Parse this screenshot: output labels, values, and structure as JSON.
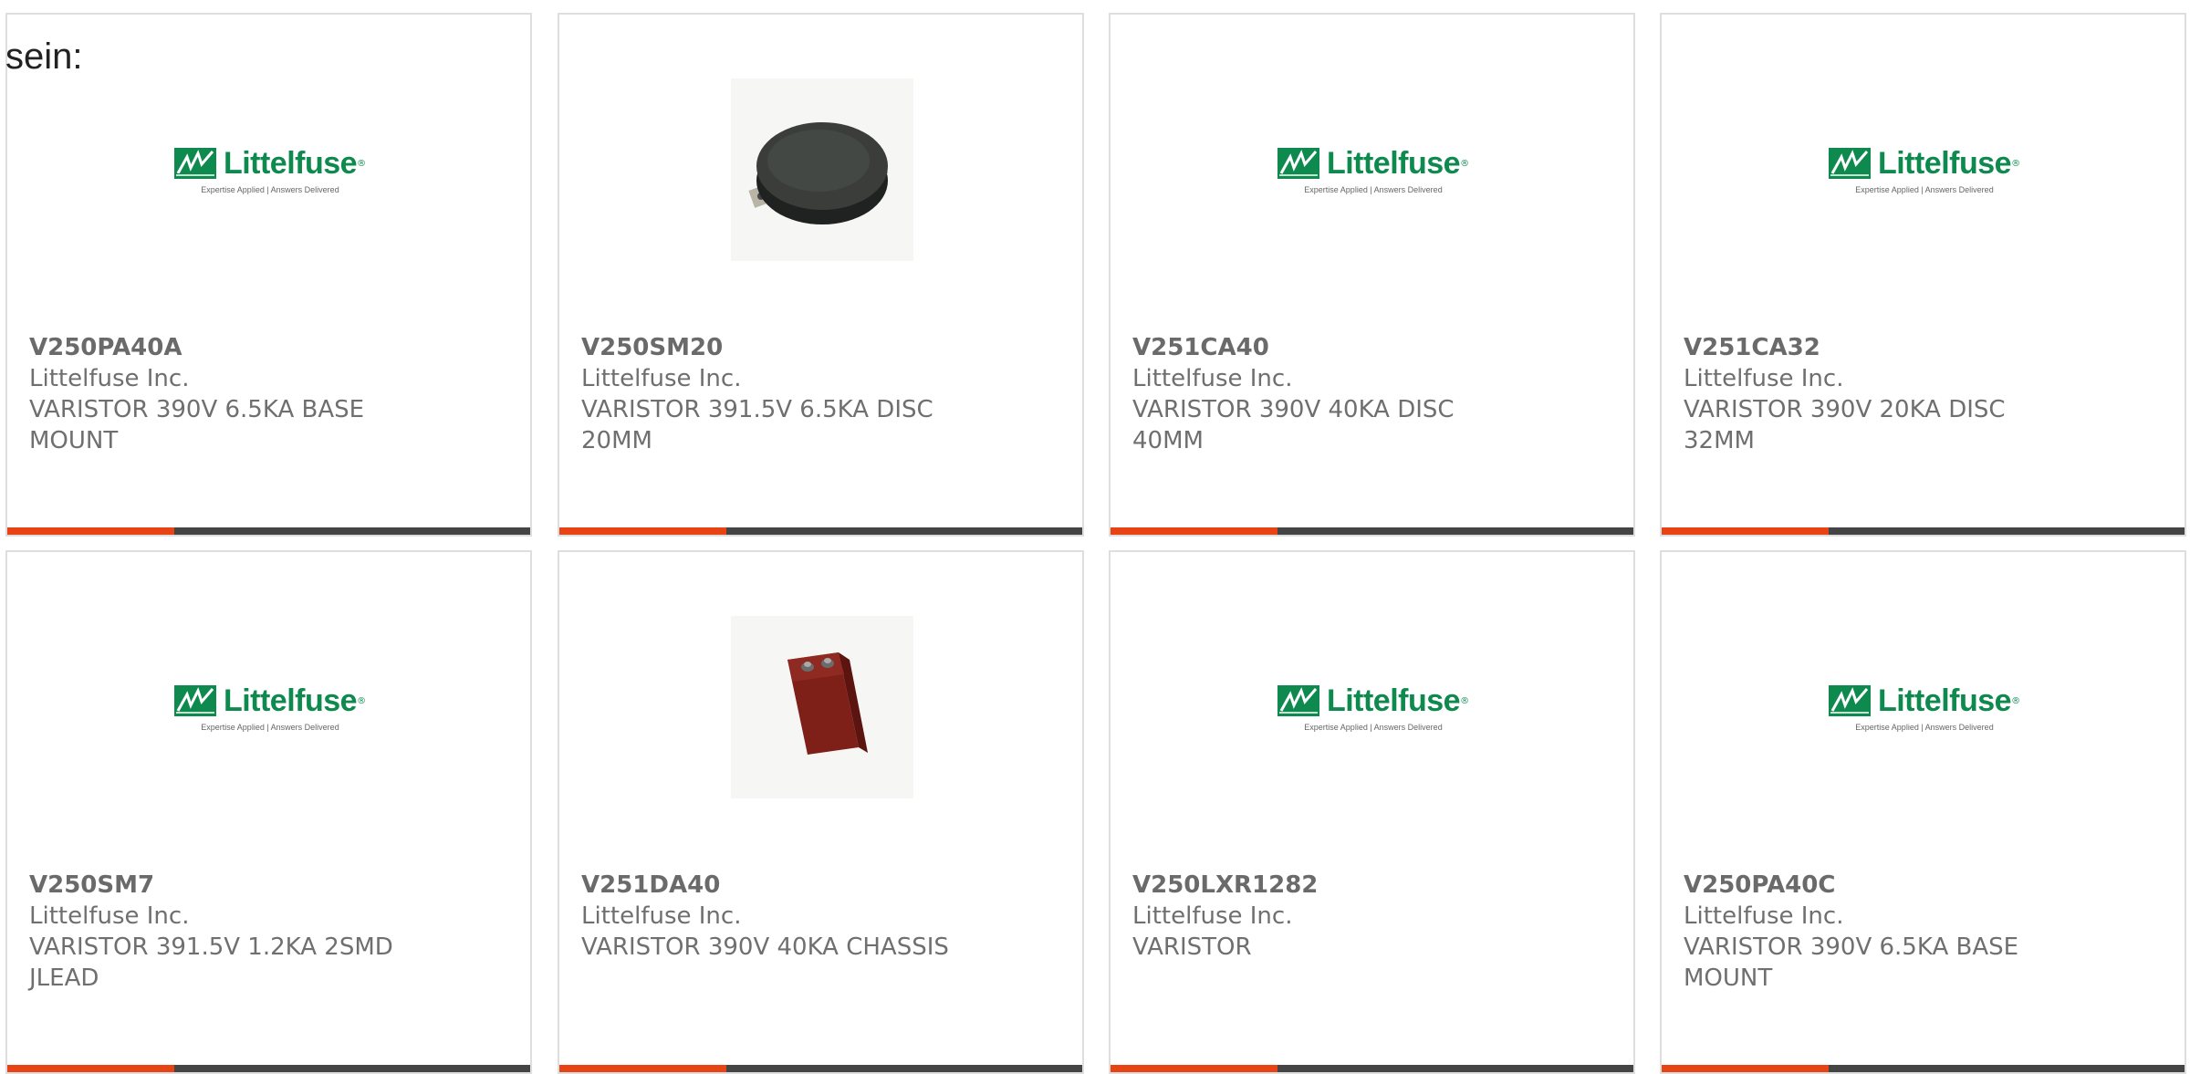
{
  "intro_text": "sein:",
  "logo": {
    "word": "Littelfuse",
    "reg": "®",
    "tagline": "Expertise Applied | Answers Delivered"
  },
  "colors": {
    "brand_green": "#0f8a4f",
    "accent_orange": "#e84314",
    "bar_dark": "#444444"
  },
  "products": [
    {
      "part_number": "V250PA40A",
      "manufacturer": "Littelfuse Inc.",
      "description": "VARISTOR 390V 6.5KA BASE MOUNT",
      "image": "littelfuse-logo"
    },
    {
      "part_number": "V250SM20",
      "manufacturer": "Littelfuse Inc.",
      "description": "VARISTOR 391.5V 6.5KA DISC 20MM",
      "image": "black-disc-varistor"
    },
    {
      "part_number": "V251CA40",
      "manufacturer": "Littelfuse Inc.",
      "description": "VARISTOR 390V 40KA DISC 40MM",
      "image": "littelfuse-logo"
    },
    {
      "part_number": "V251CA32",
      "manufacturer": "Littelfuse Inc.",
      "description": "VARISTOR 390V 20KA DISC 32MM",
      "image": "littelfuse-logo"
    },
    {
      "part_number": "V250SM7",
      "manufacturer": "Littelfuse Inc.",
      "description": "VARISTOR 391.5V 1.2KA 2SMD JLEAD",
      "image": "littelfuse-logo"
    },
    {
      "part_number": "V251DA40",
      "manufacturer": "Littelfuse Inc.",
      "description": "VARISTOR 390V 40KA CHASSIS",
      "image": "red-chassis-varistor"
    },
    {
      "part_number": "V250LXR1282",
      "manufacturer": "Littelfuse Inc.",
      "description": "VARISTOR",
      "image": "littelfuse-logo"
    },
    {
      "part_number": "V250PA40C",
      "manufacturer": "Littelfuse Inc.",
      "description": "VARISTOR 390V 6.5KA BASE MOUNT",
      "image": "littelfuse-logo"
    }
  ]
}
